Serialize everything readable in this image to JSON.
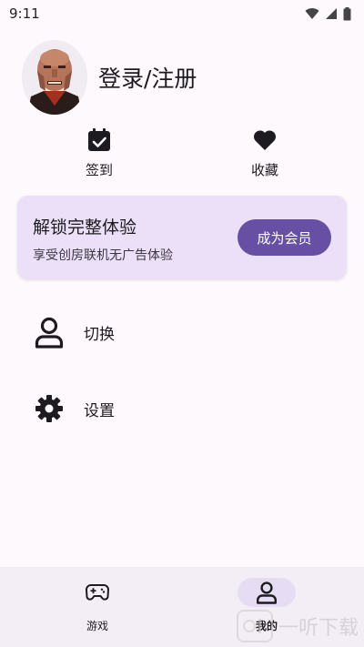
{
  "status_bar": {
    "time": "9:11"
  },
  "profile": {
    "login_text": "登录/注册"
  },
  "quick_actions": [
    {
      "label": "签到",
      "icon": "calendar-check-icon"
    },
    {
      "label": "收藏",
      "icon": "heart-icon"
    }
  ],
  "vip": {
    "title": "解锁完整体验",
    "subtitle": "享受创房联机无广告体验",
    "button_label": "成为会员",
    "accent": "#6750a4"
  },
  "menu": [
    {
      "label": "切换",
      "icon": "person-icon"
    },
    {
      "label": "设置",
      "icon": "gear-icon"
    }
  ],
  "bottom_nav": [
    {
      "label": "游戏",
      "icon": "gamepad-icon",
      "active": false
    },
    {
      "label": "我的",
      "icon": "person-icon",
      "active": true
    }
  ],
  "watermark": {
    "text": "一听下载"
  }
}
